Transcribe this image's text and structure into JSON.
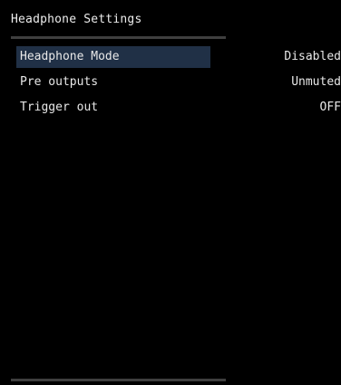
{
  "header": {
    "title": "Headphone Settings"
  },
  "menu": {
    "items": [
      {
        "label": "Headphone Mode",
        "value": "Disabled",
        "selected": true
      },
      {
        "label": "Pre outputs",
        "value": "Unmuted",
        "selected": false
      },
      {
        "label": "Trigger out",
        "value": "OFF",
        "selected": false
      }
    ]
  },
  "colors": {
    "background": "#000000",
    "text": "#e8e8e8",
    "selection": "#203046",
    "rule": "#3f3f3f"
  }
}
